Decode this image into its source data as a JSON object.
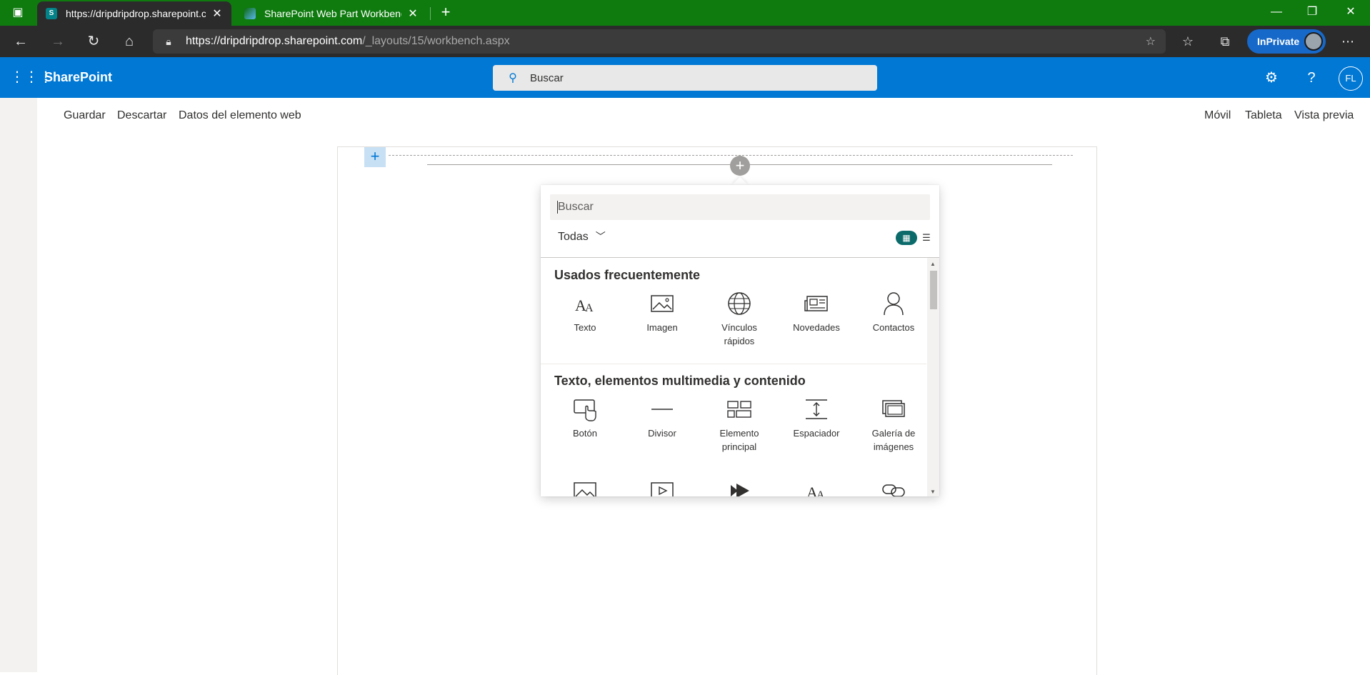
{
  "browser": {
    "tabs": [
      {
        "title": "https://dripdripdrop.sharepoint.c",
        "favicon": "sharepoint-icon",
        "active": true
      },
      {
        "title": "SharePoint Web Part Workbench",
        "favicon": "workbench-icon",
        "active": false
      }
    ],
    "url_host": "https://dripdripdrop.sharepoint.com",
    "url_path": "/_layouts/15/workbench.aspx",
    "inprivate_label": "InPrivate"
  },
  "suitebar": {
    "brand": "SharePoint",
    "search_placeholder": "Buscar",
    "avatar_initials": "FL",
    "color": "#0078d4"
  },
  "workbench": {
    "left_commands": [
      "Guardar",
      "Descartar",
      "Datos del elemento web"
    ],
    "right_commands": [
      "Móvil",
      "Tableta",
      "Vista previa"
    ]
  },
  "toolbox": {
    "search_placeholder": "Buscar",
    "filter_label": "Todas",
    "categories": [
      {
        "title": "Usados frecuentemente",
        "items": [
          {
            "label": "Texto",
            "icon": "text-icon"
          },
          {
            "label": "Imagen",
            "icon": "image-icon"
          },
          {
            "label": "Vínculos rápidos",
            "icon": "globe-icon"
          },
          {
            "label": "Novedades",
            "icon": "news-icon"
          },
          {
            "label": "Contactos",
            "icon": "contact-icon"
          }
        ]
      },
      {
        "title": "Texto, elementos multimedia y contenido",
        "items": [
          {
            "label": "Botón",
            "icon": "button-icon"
          },
          {
            "label": "Divisor",
            "icon": "divider-icon"
          },
          {
            "label": "Elemento principal",
            "icon": "hero-icon"
          },
          {
            "label": "Espaciador",
            "icon": "spacer-icon"
          },
          {
            "label": "Galería de imágenes",
            "icon": "gallery-icon"
          }
        ]
      }
    ],
    "partial_row_icons": [
      "image-icon",
      "video-icon",
      "stream-icon",
      "text-icon",
      "link-icon"
    ]
  }
}
